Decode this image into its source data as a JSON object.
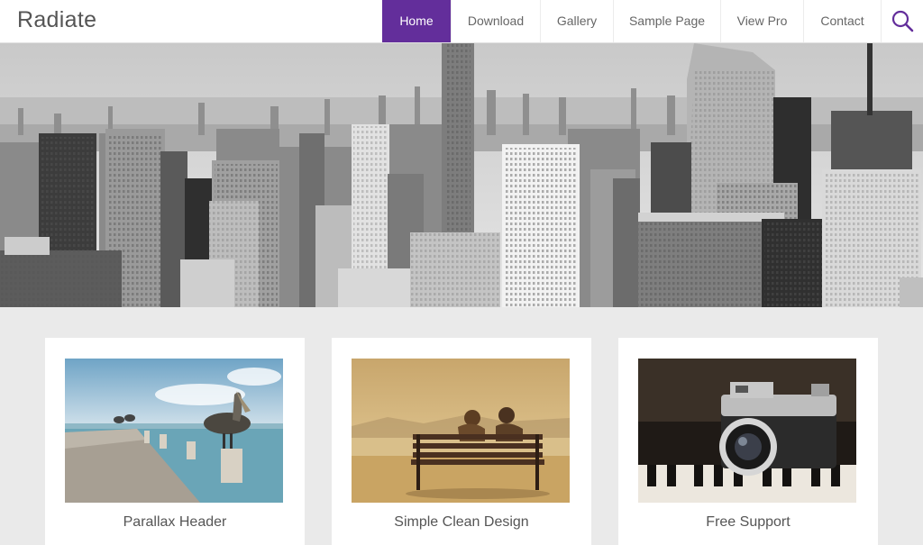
{
  "site": {
    "title": "Radiate"
  },
  "nav": {
    "items": [
      {
        "label": "Home",
        "active": true
      },
      {
        "label": "Download"
      },
      {
        "label": "Gallery"
      },
      {
        "label": "Sample Page"
      },
      {
        "label": "View Pro"
      },
      {
        "label": "Contact"
      }
    ],
    "search_icon": "search-icon"
  },
  "colors": {
    "accent": "#632e9b",
    "background": "#eaeaea"
  },
  "features": [
    {
      "title": "Parallax Header"
    },
    {
      "title": "Simple Clean Design"
    },
    {
      "title": "Free Support"
    }
  ]
}
